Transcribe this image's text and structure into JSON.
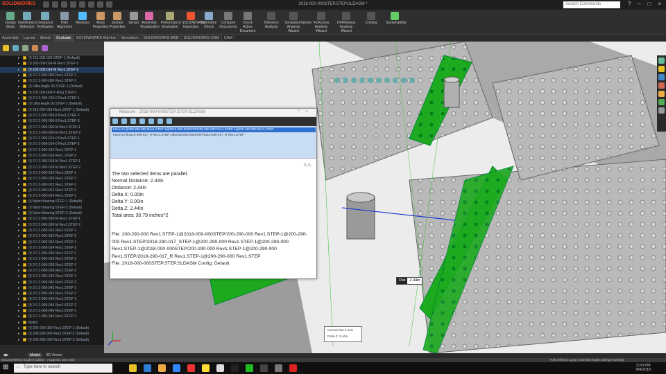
{
  "app": {
    "logo_text": "SOLIDWORKS",
    "window_title": "2018-000-000STEP.STEP.SLDASM *",
    "search_placeholder": "Search Commands"
  },
  "ribbon": [
    {
      "label": "Design Study",
      "color": "#6a8"
    },
    {
      "label": "Interference Detection",
      "color": "#7ab"
    },
    {
      "label": "Clearance Verification",
      "color": "#7ab"
    },
    {
      "label": "Hole Alignment",
      "color": "#89a"
    },
    {
      "label": "Measure",
      "color": "#5bf"
    },
    {
      "label": "Mass Properties",
      "color": "#c96"
    },
    {
      "label": "Section Properties",
      "color": "#c96"
    },
    {
      "label": "Sensor",
      "color": "#999"
    },
    {
      "label": "Assembly Visualization",
      "color": "#d6a"
    },
    {
      "label": "Performance Evaluation",
      "color": "#aa7"
    },
    {
      "label": "SOLIDWORKS Inspection",
      "color": "#e53"
    },
    {
      "label": "Symmetry Check",
      "color": "#8ac"
    },
    {
      "label": "Compare Documents",
      "color": "#777"
    },
    {
      "label": "Check Active Document",
      "color": "#777"
    },
    {
      "label": "Tolerance Analysis",
      "color": "#555"
    },
    {
      "label": "SimulationXpress Analysis Wizard",
      "color": "#555"
    },
    {
      "label": "FloXpress Analysis Wizard",
      "color": "#555"
    },
    {
      "label": "DFMXpress Analysis Wizard",
      "color": "#555"
    },
    {
      "label": "Costing",
      "color": "#555"
    },
    {
      "label": "Sustainability",
      "color": "#6c6"
    }
  ],
  "tabs": [
    "Assembly",
    "Layout",
    "Sketch",
    "Evaluate",
    "SOLIDWORKS Add-Ins",
    "Simulation",
    "SOLIDWORKS MBD",
    "SOLIDWORKS CAM",
    "CAM"
  ],
  "active_tab": "Evaluate",
  "tree": {
    "rows": [
      "(f) 212-000-000 STEP-1 (Default)",
      "(f) 202-000-014-M Rev1.STEP-1",
      "(f) 202-000-014-M Rev1.STEP-2",
      "(f) 2 0 2-000-000 Rev1.STEP-1",
      "(f) 2 0 2-000-000 Rev1.STEP-2",
      "(f) Ultra Angle SS STEP-1 (Default)",
      "(f) 202-000-004 P-Ring STEP-1",
      "(f) 2 0 2-000-010-0 Rev1.STEP-1",
      "(f) Ultra Angle 0b STEP-1 (Default)",
      "(f) 212-000-018 Rev1.STEP-1 (Default)",
      "(f) 2 0 2-000-000-8 Rev1.STEP-2",
      "(f) 2 0 2-000-000-8 Rev1.STEP-3",
      "(f) 2 0 2-000-000-M Rev1.STEP-1",
      "(f) 2 0 2-000-000-M Rev1.STEP-2",
      "(f) 2 0 2-000-014-0 Rev1.STEP-1",
      "(f) 2 0 2-000-014-0 Rev1.STEP-2",
      "(f) 2 0 2-000-016 Rev1.STEP-1",
      "(f) 2 0 2-000-016 Rev1.STEP-2",
      "(f) 2 0 2-000-018-M Rev1.STEP-1",
      "(f) 2 0 2-000-018-M Rev1.STEP-2",
      "(f) 2 0 2-000-020 Rev1.STEP-1",
      "(f) 2 0 2-000-020 Rev1.STEP-2",
      "(f) 2 0 2-000-022 Rev1.STEP-1",
      "(f) 2 0 2-000-022 Rev1.STEP-2",
      "(f) 2 0 2-000-024 Rev1.STEP-1",
      "(f) Nylon Bearing STEP-1 (Default)",
      "(f) Nylon Bearing STEP-2 (Default)",
      "(f) Nylon Bearing STEP-3 (Default)",
      "(f) 2 0 2-000-030-M Rev1.STEP-1",
      "(f) 2 0 2-000-030-M Rev1.STEP-2",
      "(f) 2 0 2-000-032 Rev1.STEP-1",
      "(f) 2 0 2-000-032 Rev1.STEP-2",
      "(f) 2 0 2-000-034 Rev1.STEP-1",
      "(f) 2 0 2-000-034 Rev1.STEP-2",
      "(f) 2 0 2-000-036 Rev1.STEP-1",
      "(f) 2 0 2-000-036 Rev1.STEP-2",
      "(f) 2 0 2-000-038 Rev1.STEP-1",
      "(f) 2 0 2-000-038 Rev1.STEP-2",
      "(f) 2 0 2-000-040 Rev1.STEP-1",
      "(f) 2 0 2-000-040 Rev1.STEP-2",
      "(f) 2 0 2-000-042 Rev1.STEP-1",
      "(f) 2 0 2-000-042 Rev1.STEP-2",
      "(f) 2 0 2-000-044 Rev1.STEP-1",
      "(f) 2 0 2-000-044 Rev1.STEP-2",
      "(f) 2 0 2-000-046 Rev1.STEP-1",
      "(f) 2 0 2-000-046 Rev1.STEP-2",
      "Mates",
      "(f) 200-290-000 Rev1.STEP-1 (Default)",
      "(f) 200-290-000 Rev1.STEP-2 (Default)",
      "(f) 200-290-000 Rev1.STEP-3 (Default)"
    ],
    "selected_index": 2
  },
  "measure": {
    "title": "Measure - 2018-000-000STEP.STEP.SLDASM",
    "selection_1": "Face<1>@200-290-000 Rev1.STEP-1@2018-000-000STEP/200-290-000 Rev1.STEP-1@200-290-000 Rev1.STEP",
    "selection_2": "Face<2>@2018-290-017_R Rev1.STEP-1@2018-000-000STEP/2018-290-017_R Rev1.STEP",
    "result_lines": [
      "The two selected items are parallel.",
      "Normal Distance: 2.44in",
      "Distance: 2.44in",
      "Delta X: 0.00in",
      "Delta Y: 0.00in",
      "Delta Z: 2.44in",
      "Total area: 30.79 inches^2"
    ],
    "file_lines": [
      "File: 200-290-000 Rev1.STEP-1@2018-000-000STEP/200-290-000 Rev1.STEP-1@200-290-",
      "000 Rev1.STEP/2018-290-017_STEP-1@200-290-000 Rev1.STEP-1@200-290-000",
      "Rev1.STEP-1@2018-000-000STEP/200-290-000 Rev1.STEP-1@200-290-000",
      "Rev1.STEP/2018-290-017_R Rev1.STEP-1@200-290-000 Rev1.STEP",
      "File: 2018-000-000STEP.STEP.SLDASM Config: Default"
    ]
  },
  "callout": {
    "key": "Dist",
    "value": "2.44in"
  },
  "coord_box": {
    "line1": "Normal Dist 2.44in",
    "line2": "Delta Z: 2.44in"
  },
  "bottom_tabs": [
    "Model",
    "3D Views"
  ],
  "active_bottom_tab": "Model",
  "status_left": "SOLIDWORKS Student Edition - Academic Use Only",
  "status_right": "Fully Defined   Large Assembly Mode   Editing Assembly",
  "taskbar": {
    "search_placeholder": "Type here to search",
    "time": "3:00 PM",
    "date": "9/4/2018",
    "apps": [
      "#e8c028",
      "#2d7dd2",
      "#ea4",
      "#38f",
      "#e33",
      "#fd3",
      "#ddd",
      "#222",
      "#2b2",
      "#444",
      "#777",
      "#d22"
    ]
  },
  "colors": {
    "accent": "#2f6fcf",
    "green_part": "#1eaa1e",
    "steel": "#b9b9b9"
  }
}
